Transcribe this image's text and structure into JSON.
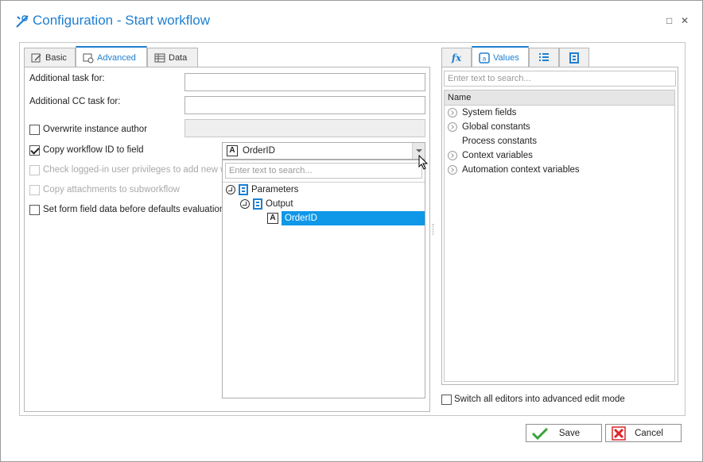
{
  "window": {
    "title": "Configuration - Start workflow",
    "maximize_glyph": "□",
    "close_glyph": "✕"
  },
  "left_tabs": [
    {
      "label": "Basic",
      "icon": "pencil-icon"
    },
    {
      "label": "Advanced",
      "icon": "gear-form-icon"
    },
    {
      "label": "Data",
      "icon": "table-icon"
    }
  ],
  "form": {
    "additional_task_label": "Additional task for:",
    "additional_cc_label": "Additional CC task for:",
    "overwrite_author_label": "Overwrite instance author",
    "copy_workflow_id_label": "Copy workflow ID to field",
    "check_privileges_label": "Check logged-in user privileges to add new wor",
    "copy_attachments_label": "Copy attachments to subworkflow",
    "set_form_field_label": "Set form field data before defaults evaluation (",
    "copy_workflow_id_checked": true
  },
  "field_picker": {
    "type_glyph": "A",
    "selected_value": "OrderID",
    "search_placeholder": "Enter text to search...",
    "tree": [
      {
        "label": "Parameters",
        "level": 0
      },
      {
        "label": "Output",
        "level": 1
      },
      {
        "label": "OrderID",
        "level": 2,
        "selected": true
      }
    ]
  },
  "right_tabs": [
    {
      "label": "fx",
      "icon": "function-icon"
    },
    {
      "label": "Values",
      "icon": "values-icon"
    },
    {
      "label": "",
      "icon": "list-icon"
    },
    {
      "label": "",
      "icon": "form-icon"
    }
  ],
  "values_panel": {
    "search_placeholder": "Enter text to search...",
    "column_header": "Name",
    "items": [
      {
        "label": "System fields",
        "expandable": true
      },
      {
        "label": "Global constants",
        "expandable": true
      },
      {
        "label": "Process constants",
        "expandable": false
      },
      {
        "label": "Context variables",
        "expandable": true
      },
      {
        "label": "Automation context variables",
        "expandable": true
      }
    ]
  },
  "advanced_mode_label": "Switch all editors into advanced edit mode",
  "buttons": {
    "save": "Save",
    "cancel": "Cancel"
  },
  "colors": {
    "accent": "#1e7fd0",
    "selection": "#0f97e8",
    "save_check": "#3aa33a",
    "cancel_x": "#d9262a"
  }
}
